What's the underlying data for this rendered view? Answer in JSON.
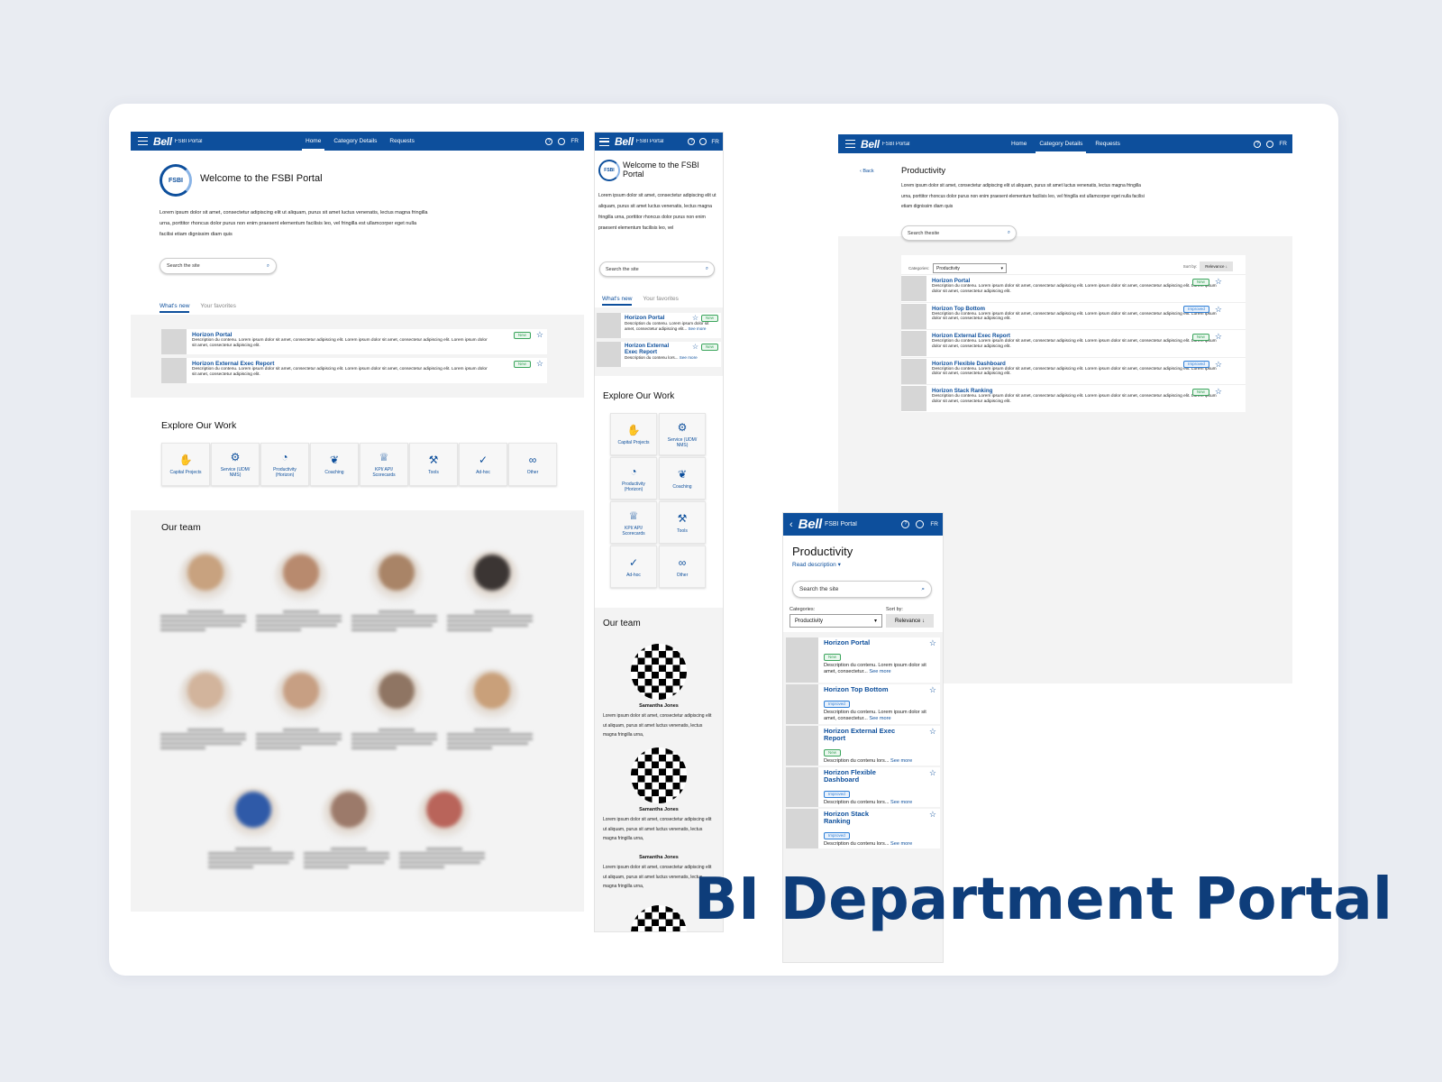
{
  "banner_title": "BI Department Portal",
  "header": {
    "brand": "Bell",
    "portal": "FSBI Portal",
    "lang": "FR",
    "nav": [
      "Home",
      "Category Details",
      "Requests"
    ]
  },
  "home": {
    "logo_text": "FSBI",
    "welcome": "Welcome to the FSBI Portal",
    "welcome_mobile": "Welcome to the FSBI Portal",
    "intro": "Lorem ipsum dolor sit amet, consectetur adipiscing elit ut aliquam, purus sit amet luctus venenatis, lectus magna fringilla urna, porttitor rhoncus dolor purus non enim praesent elementum facilisis leo, vel fringilla est ullamcorper eget nulla facilisi etiam dignissim diam quis",
    "intro_mobile": "Lorem ipsum dolor sit amet, consectetur adipiscing elit ut aliquam, purus sit amet luctus venenatis, lectus magna fringilla urna, porttitor rhoncus dolor purus non enim praesent elementum facilisis leo, vel",
    "search_placeholder": "Search the site",
    "tabs": [
      "What's new",
      "Your favorites"
    ],
    "news": [
      {
        "title": "Horizon Portal",
        "badge": "New",
        "desc": "Description du contenu. Lorem ipsum dolor sit amet, consectetur adipiscing elit. Lorem ipsum dolor sit amet, consectetur adipiscing elit. Lorem ipsum dolor sit amet, consectetur adipiscing elit."
      },
      {
        "title": "Horizon External Exec Report",
        "badge": "New",
        "desc": "Description du contenu. Lorem ipsum dolor sit amet, consectetur adipiscing elit. Lorem ipsum dolor sit amet, consectetur adipiscing elit. Lorem ipsum dolor sit amet, consectetur adipiscing elit."
      }
    ],
    "news_mobile": [
      {
        "title": "Horizon Portal",
        "badge": "New",
        "desc": "Description du contenu. Lorem ipsum dolor sit amet, consectetur adipiscing elit...",
        "see": "See more"
      },
      {
        "title": "Horizon External Exec Report",
        "badge": "New",
        "desc": "Description du contenu lors...",
        "see": "See more"
      }
    ],
    "explore_title": "Explore Our Work",
    "explore": [
      {
        "label": "Capital Projects",
        "icon": "handshake-icon",
        "glyph": "✋"
      },
      {
        "label": "Service (UDM/ NMS)",
        "icon": "gear-icon",
        "glyph": "⚙"
      },
      {
        "label": "Productivity (Horizon)",
        "icon": "speed-icon",
        "glyph": "◔"
      },
      {
        "label": "Coaching",
        "icon": "brain-icon",
        "glyph": "❦"
      },
      {
        "label": "KPI/ API/ Scorecards",
        "icon": "trophy-icon",
        "glyph": "♕"
      },
      {
        "label": "Tools",
        "icon": "wrench-icon",
        "glyph": "⚒"
      },
      {
        "label": "Ad-hoc",
        "icon": "check-icon",
        "glyph": "✓"
      },
      {
        "label": "Other",
        "icon": "infinity-icon",
        "glyph": "∞"
      }
    ],
    "team_title": "Our team",
    "team_mobile": [
      {
        "name": "Samantha Jones",
        "bio": "Lorem ipsum dolor sit amet, consectetur adipiscing elit ut aliquam, purus sit amet luctus venenatis, lectus magna fringilla urna,"
      },
      {
        "name": "Samantha Jones",
        "bio": "Lorem ipsum dolor sit amet, consectetur adipiscing elit ut aliquam, purus sit amet luctus venenatis, lectus magna fringilla urna,"
      },
      {
        "name": "Samantha Jones",
        "bio": "Lorem ipsum dolor sit amet, consectetur adipiscing elit ut aliquam, purus sit amet luctus venenatis, lectus magna fringilla urna,"
      }
    ]
  },
  "category": {
    "back": "Back",
    "title": "Productivity",
    "intro": "Lorem ipsum dolor sit amet, consectetur adipiscing elit ut aliquam, purus sit amet luctus venenatis, lectus magna fringilla urna, porttitor rhoncus dolor purus non enim praesent elementum facilisis leo, vel fringilla est ullamcorper eget nulla facilisi etiam dignissim diam quis",
    "read_description": "Read description",
    "search_placeholder": "Search thesite",
    "search_placeholder_mobile": "Search the site",
    "categories_label": "Categories:",
    "category_value": "Productivity",
    "sort_label": "Sort by:",
    "sort_value": "Relevance ↓",
    "items": [
      {
        "title": "Horizon Portal",
        "badge": "New",
        "desc": "Description du contenu. Lorem ipsum dolor sit amet, consectetur adipiscing elit. Lorem ipsum dolor sit amet, consectetur adipiscing elit. Lorem ipsum dolor sit amet, consectetur adipiscing elit.",
        "mdesc": "Description du contenu. Lorem ipsum dolor sit amet, consectetur...",
        "see": "See more"
      },
      {
        "title": "Horizon Top Bottom",
        "badge": "Improved",
        "desc": "Description du contenu. Lorem ipsum dolor sit amet, consectetur adipiscing elit. Lorem ipsum dolor sit amet, consectetur adipiscing elit. Lorem ipsum dolor sit amet, consectetur adipiscing elit.",
        "mdesc": "Description du contenu. Lorem ipsum dolor sit amet, consectetur...",
        "see": "See more"
      },
      {
        "title": "Horizon External Exec Report",
        "badge": "New",
        "desc": "Description du contenu. Lorem ipsum dolor sit amet, consectetur adipiscing elit. Lorem ipsum dolor sit amet, consectetur adipiscing elit. Lorem ipsum dolor sit amet, consectetur adipiscing elit.",
        "mdesc": "Description du contenu lors...",
        "see": "See more"
      },
      {
        "title": "Horizon Flexible Dashboard",
        "badge": "Improved",
        "desc": "Description du contenu. Lorem ipsum dolor sit amet, consectetur adipiscing elit. Lorem ipsum dolor sit amet, consectetur adipiscing elit. Lorem ipsum dolor sit amet, consectetur adipiscing elit.",
        "mdesc": "Description du contenu lors...",
        "see": "See more"
      },
      {
        "title": "Horizon Stack Ranking",
        "badge": "New",
        "mbadge": "Improved",
        "desc": "Description du contenu. Lorem ipsum dolor sit amet, consectetur adipiscing elit. Lorem ipsum dolor sit amet, consectetur adipiscing elit. Lorem ipsum dolor sit amet, consectetur adipiscing elit.",
        "mdesc": "Description du contenu lors...",
        "see": "See more"
      }
    ]
  },
  "colors": {
    "brand": "#0d4f9c",
    "title": "#0e3d7a",
    "new": "#3ba55c",
    "improved": "#2f7fd6"
  }
}
